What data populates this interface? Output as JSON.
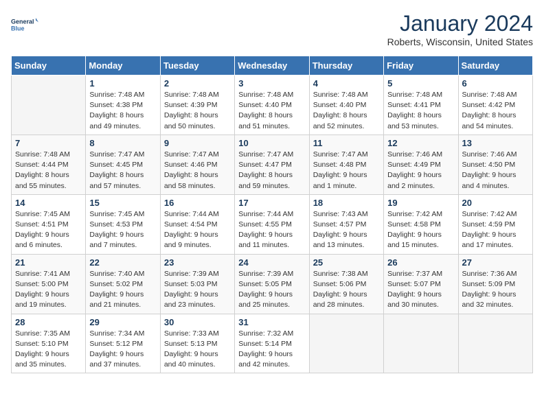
{
  "header": {
    "logo_line1": "General",
    "logo_line2": "Blue",
    "month": "January 2024",
    "location": "Roberts, Wisconsin, United States"
  },
  "weekdays": [
    "Sunday",
    "Monday",
    "Tuesday",
    "Wednesday",
    "Thursday",
    "Friday",
    "Saturday"
  ],
  "weeks": [
    [
      {
        "day": "",
        "empty": true
      },
      {
        "day": "1",
        "sunrise": "7:48 AM",
        "sunset": "4:38 PM",
        "daylight": "8 hours and 49 minutes."
      },
      {
        "day": "2",
        "sunrise": "7:48 AM",
        "sunset": "4:39 PM",
        "daylight": "8 hours and 50 minutes."
      },
      {
        "day": "3",
        "sunrise": "7:48 AM",
        "sunset": "4:40 PM",
        "daylight": "8 hours and 51 minutes."
      },
      {
        "day": "4",
        "sunrise": "7:48 AM",
        "sunset": "4:40 PM",
        "daylight": "8 hours and 52 minutes."
      },
      {
        "day": "5",
        "sunrise": "7:48 AM",
        "sunset": "4:41 PM",
        "daylight": "8 hours and 53 minutes."
      },
      {
        "day": "6",
        "sunrise": "7:48 AM",
        "sunset": "4:42 PM",
        "daylight": "8 hours and 54 minutes."
      }
    ],
    [
      {
        "day": "7",
        "sunrise": "7:48 AM",
        "sunset": "4:44 PM",
        "daylight": "8 hours and 55 minutes."
      },
      {
        "day": "8",
        "sunrise": "7:47 AM",
        "sunset": "4:45 PM",
        "daylight": "8 hours and 57 minutes."
      },
      {
        "day": "9",
        "sunrise": "7:47 AM",
        "sunset": "4:46 PM",
        "daylight": "8 hours and 58 minutes."
      },
      {
        "day": "10",
        "sunrise": "7:47 AM",
        "sunset": "4:47 PM",
        "daylight": "8 hours and 59 minutes."
      },
      {
        "day": "11",
        "sunrise": "7:47 AM",
        "sunset": "4:48 PM",
        "daylight": "9 hours and 1 minute."
      },
      {
        "day": "12",
        "sunrise": "7:46 AM",
        "sunset": "4:49 PM",
        "daylight": "9 hours and 2 minutes."
      },
      {
        "day": "13",
        "sunrise": "7:46 AM",
        "sunset": "4:50 PM",
        "daylight": "9 hours and 4 minutes."
      }
    ],
    [
      {
        "day": "14",
        "sunrise": "7:45 AM",
        "sunset": "4:51 PM",
        "daylight": "9 hours and 6 minutes."
      },
      {
        "day": "15",
        "sunrise": "7:45 AM",
        "sunset": "4:53 PM",
        "daylight": "9 hours and 7 minutes."
      },
      {
        "day": "16",
        "sunrise": "7:44 AM",
        "sunset": "4:54 PM",
        "daylight": "9 hours and 9 minutes."
      },
      {
        "day": "17",
        "sunrise": "7:44 AM",
        "sunset": "4:55 PM",
        "daylight": "9 hours and 11 minutes."
      },
      {
        "day": "18",
        "sunrise": "7:43 AM",
        "sunset": "4:57 PM",
        "daylight": "9 hours and 13 minutes."
      },
      {
        "day": "19",
        "sunrise": "7:42 AM",
        "sunset": "4:58 PM",
        "daylight": "9 hours and 15 minutes."
      },
      {
        "day": "20",
        "sunrise": "7:42 AM",
        "sunset": "4:59 PM",
        "daylight": "9 hours and 17 minutes."
      }
    ],
    [
      {
        "day": "21",
        "sunrise": "7:41 AM",
        "sunset": "5:00 PM",
        "daylight": "9 hours and 19 minutes."
      },
      {
        "day": "22",
        "sunrise": "7:40 AM",
        "sunset": "5:02 PM",
        "daylight": "9 hours and 21 minutes."
      },
      {
        "day": "23",
        "sunrise": "7:39 AM",
        "sunset": "5:03 PM",
        "daylight": "9 hours and 23 minutes."
      },
      {
        "day": "24",
        "sunrise": "7:39 AM",
        "sunset": "5:05 PM",
        "daylight": "9 hours and 25 minutes."
      },
      {
        "day": "25",
        "sunrise": "7:38 AM",
        "sunset": "5:06 PM",
        "daylight": "9 hours and 28 minutes."
      },
      {
        "day": "26",
        "sunrise": "7:37 AM",
        "sunset": "5:07 PM",
        "daylight": "9 hours and 30 minutes."
      },
      {
        "day": "27",
        "sunrise": "7:36 AM",
        "sunset": "5:09 PM",
        "daylight": "9 hours and 32 minutes."
      }
    ],
    [
      {
        "day": "28",
        "sunrise": "7:35 AM",
        "sunset": "5:10 PM",
        "daylight": "9 hours and 35 minutes."
      },
      {
        "day": "29",
        "sunrise": "7:34 AM",
        "sunset": "5:12 PM",
        "daylight": "9 hours and 37 minutes."
      },
      {
        "day": "30",
        "sunrise": "7:33 AM",
        "sunset": "5:13 PM",
        "daylight": "9 hours and 40 minutes."
      },
      {
        "day": "31",
        "sunrise": "7:32 AM",
        "sunset": "5:14 PM",
        "daylight": "9 hours and 42 minutes."
      },
      {
        "day": "",
        "empty": true
      },
      {
        "day": "",
        "empty": true
      },
      {
        "day": "",
        "empty": true
      }
    ]
  ]
}
